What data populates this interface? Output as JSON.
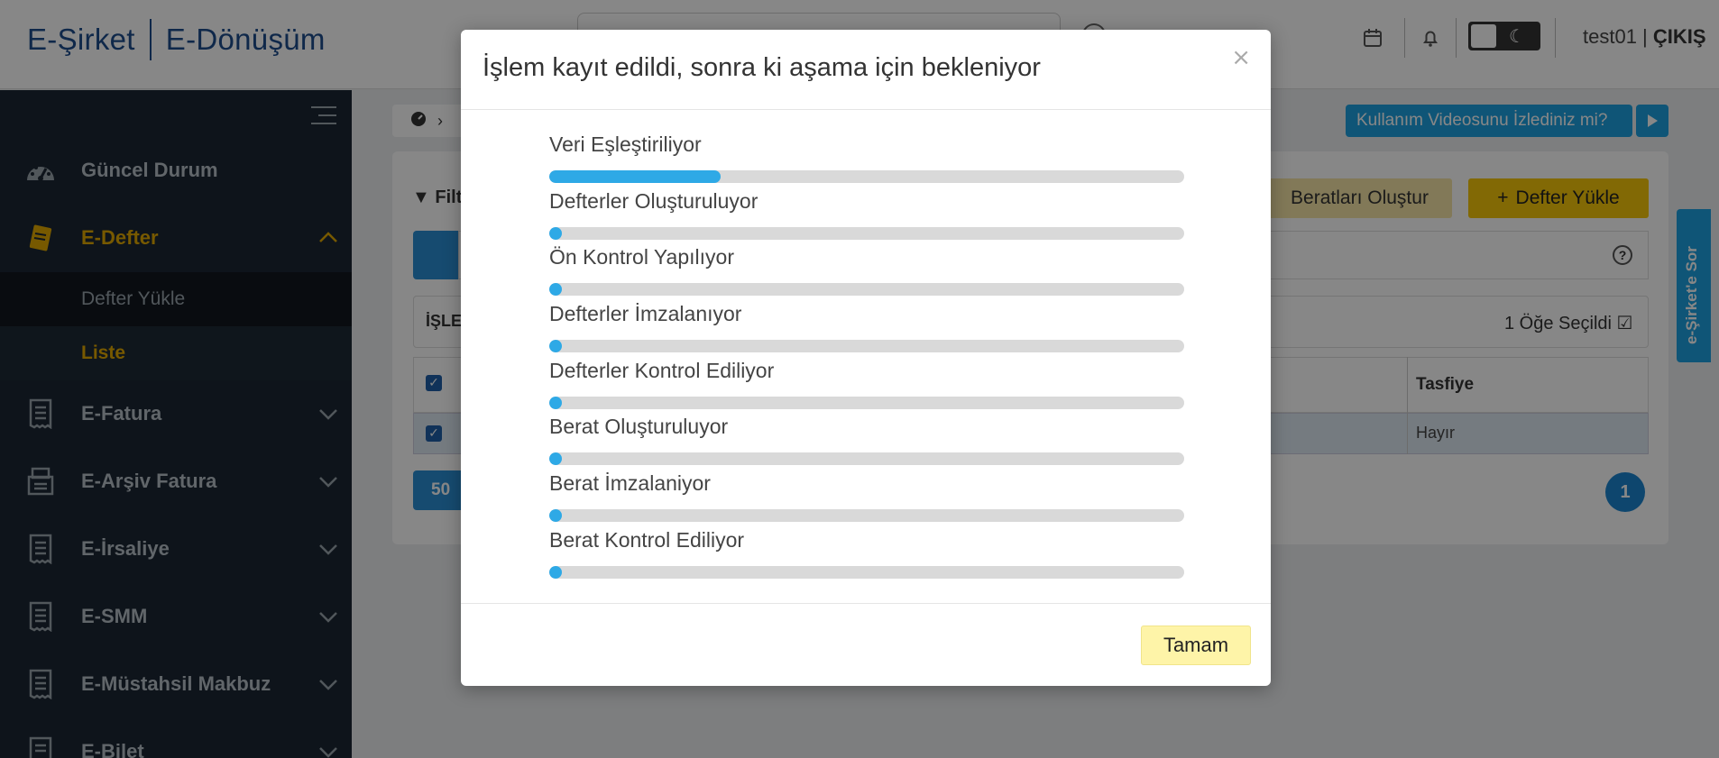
{
  "header": {
    "brand_left": "E-Şirket",
    "brand_right": "E-Dönüşüm",
    "user": "test01",
    "logout": "ÇIKIŞ"
  },
  "sidebar": {
    "items": [
      {
        "label": "Güncel Durum",
        "icon": "dashboard-icon"
      },
      {
        "label": "E-Defter",
        "icon": "book-icon"
      },
      {
        "label": "E-Fatura",
        "icon": "receipt-icon"
      },
      {
        "label": "E-Arşiv Fatura",
        "icon": "archive-icon"
      },
      {
        "label": "E-İrsaliye",
        "icon": "receipt-icon"
      },
      {
        "label": "E-SMM",
        "icon": "receipt-icon"
      },
      {
        "label": "E-Müstahsil Makbuz",
        "icon": "receipt-icon"
      },
      {
        "label": "E-Bilet",
        "icon": "receipt-icon"
      }
    ],
    "sub_items": [
      "Defter Yükle",
      "Liste"
    ]
  },
  "main": {
    "video_button": "Kullanım Videosunu İzlediniz mi?",
    "filter_label": "Filt",
    "btn_beratlar": "Beratları Oluştur",
    "btn_defter_yukle": "Defter Yükle",
    "islem_label": "İŞLEM",
    "selected_text": "1 Öğe Seçildi",
    "tasfiye_header": "Tasfiye",
    "tasfiye_value": "Hayır",
    "page_size": "50",
    "current_page": "1",
    "ask_tab": "e-Şirket'e Sor"
  },
  "modal": {
    "title": "İşlem kayıt edildi, sonra ki aşama için bekleniyor",
    "close": "×",
    "steps": [
      {
        "label": "Veri Eşleştiriliyor",
        "progress": 0.27
      },
      {
        "label": "Defterler Oluşturuluyor",
        "progress": 0
      },
      {
        "label": "Ön Kontrol Yapılıyor",
        "progress": 0
      },
      {
        "label": "Defterler İmzalanıyor",
        "progress": 0
      },
      {
        "label": "Defterler Kontrol Ediliyor",
        "progress": 0
      },
      {
        "label": "Berat Oluşturuluyor",
        "progress": 0
      },
      {
        "label": "Berat İmzalaniyor",
        "progress": 0
      },
      {
        "label": "Berat Kontrol Ediliyor",
        "progress": 0
      }
    ],
    "ok_button": "Tamam"
  },
  "colors": {
    "brand": "#1e4d8c",
    "accent_yellow": "#e0a800",
    "progress": "#2ea9e6",
    "sidebar_bg": "#1b2733"
  }
}
